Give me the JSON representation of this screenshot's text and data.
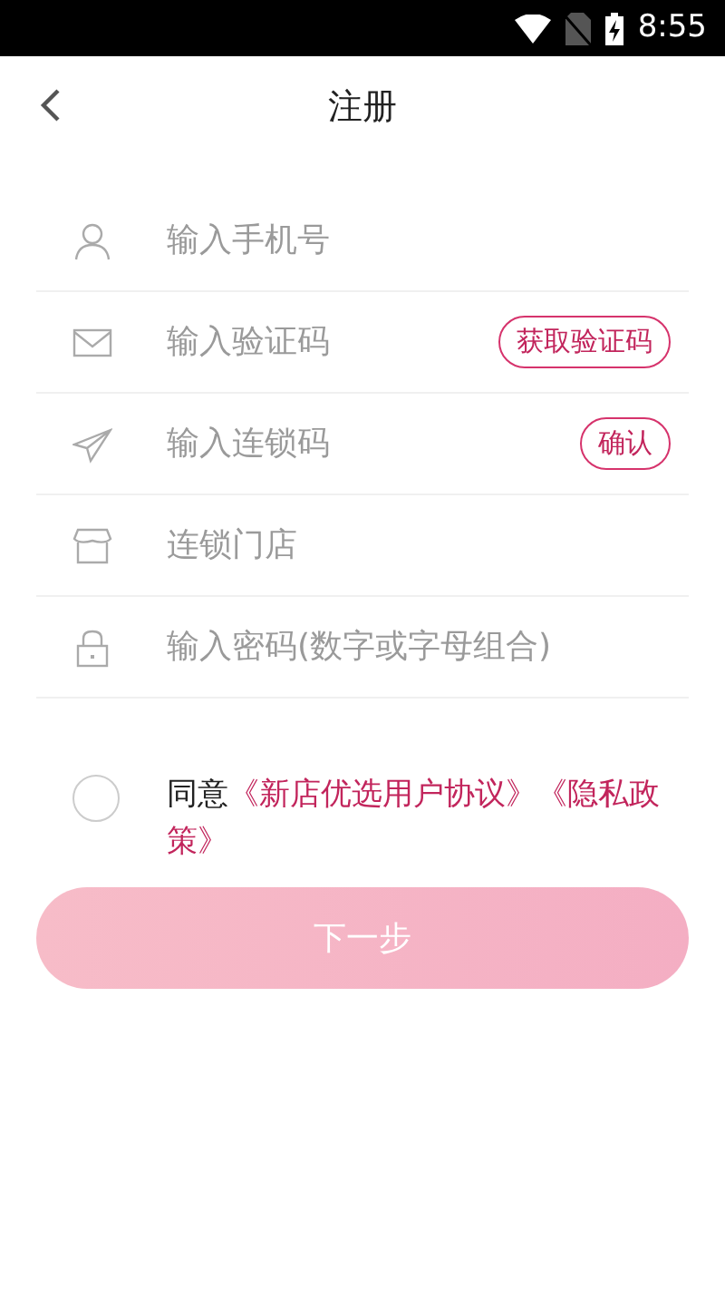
{
  "status_bar": {
    "time": "8:55"
  },
  "header": {
    "title": "注册"
  },
  "fields": [
    {
      "kind": "phone",
      "placeholder": "输入手机号"
    },
    {
      "kind": "code",
      "placeholder": "输入验证码",
      "action": "获取验证码"
    },
    {
      "kind": "chain",
      "placeholder": "输入连锁码",
      "action": "确认"
    },
    {
      "kind": "store",
      "placeholder": "连锁门店"
    },
    {
      "kind": "password",
      "placeholder": "输入密码(数字或字母组合)"
    }
  ],
  "agreement": {
    "checked": false,
    "prefix": "同意",
    "links": [
      "《新店优选用户协议》",
      "《隐私政策》"
    ]
  },
  "next_button": {
    "label": "下一步",
    "disabled": true
  }
}
